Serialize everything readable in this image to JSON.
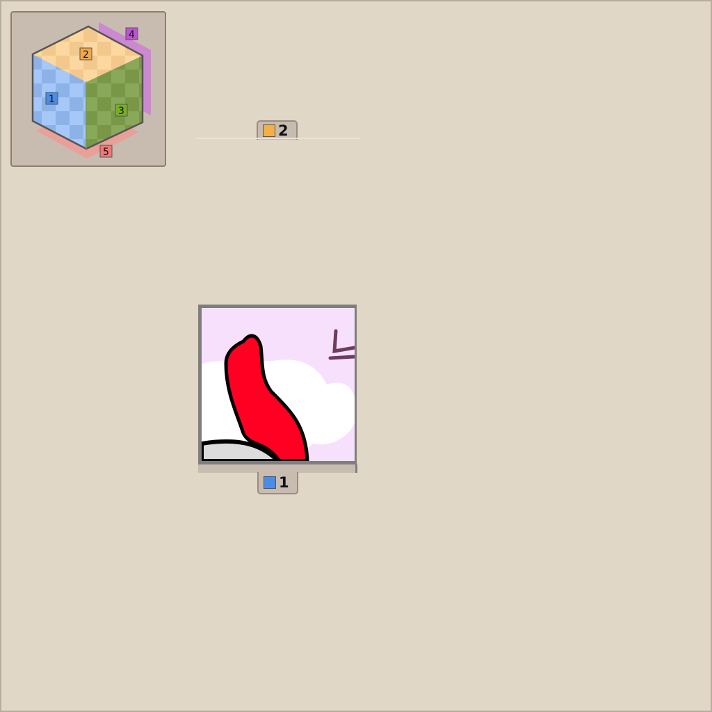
{
  "cube_navigator": {
    "faces": [
      {
        "label": "1",
        "color": "#4a8ce8"
      },
      {
        "label": "2",
        "color": "#f4a844"
      },
      {
        "label": "3",
        "color": "#78b020"
      },
      {
        "label": "4",
        "color": "#c050d8"
      },
      {
        "label": "5",
        "color": "#f07878"
      }
    ]
  },
  "viewer": {
    "top_tab": {
      "label": "2",
      "color": "#f4b048"
    },
    "bottom_tab": {
      "label": "1",
      "color": "#4a8ce8"
    }
  }
}
